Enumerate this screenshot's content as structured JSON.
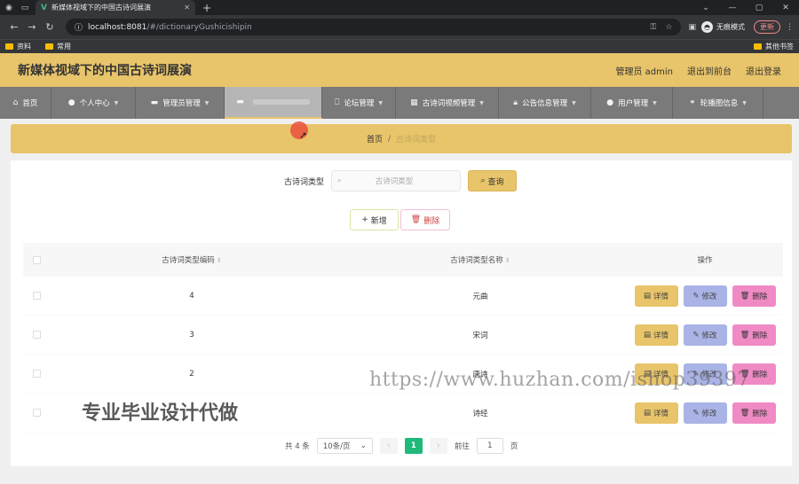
{
  "browser": {
    "tab_title": "新媒体视域下的中国古诗词展演",
    "url_host": "localhost:8081",
    "url_path": "/#/dictionaryGushicishipin",
    "profile_label": "无痕模式",
    "update_label": "更新",
    "bookmarks": [
      "资料",
      "常用"
    ],
    "other_bookmarks": "其他书签"
  },
  "header": {
    "title": "新媒体视域下的中国古诗词展演",
    "user": "管理员 admin",
    "back_front": "退出到前台",
    "logout": "退出登录"
  },
  "menu": [
    {
      "label": "首页",
      "icon": "home-icon"
    },
    {
      "label": "个人中心",
      "icon": "user-icon"
    },
    {
      "label": "管理员管理",
      "icon": "monitor-icon"
    },
    {
      "label": "",
      "icon": "monitor-icon",
      "active": true
    },
    {
      "label": "论坛管理",
      "icon": "forum-icon"
    },
    {
      "label": "古诗词视频管理",
      "icon": "grid-icon"
    },
    {
      "label": "公告信息管理",
      "icon": "lock-icon"
    },
    {
      "label": "用户管理",
      "icon": "user-icon"
    },
    {
      "label": "轮播图信息",
      "icon": "link-icon"
    }
  ],
  "breadcrumb": {
    "home": "首页",
    "sep": "/",
    "current": "古诗词类型"
  },
  "search": {
    "label": "古诗词类型",
    "placeholder": "古诗词类型",
    "query_button": "查询"
  },
  "actions": {
    "add": "新增",
    "delete": "删除"
  },
  "table": {
    "headers": {
      "code": "古诗词类型编码",
      "name": "古诗词类型名称",
      "ops": "操作"
    },
    "rows": [
      {
        "code": "4",
        "name": "元曲"
      },
      {
        "code": "3",
        "name": "宋词"
      },
      {
        "code": "2",
        "name": "唐诗"
      },
      {
        "code": "",
        "name": "诗经"
      }
    ],
    "row_actions": {
      "detail": "详情",
      "edit": "修改",
      "delete": "删除"
    }
  },
  "pagination": {
    "total": "共 4 条",
    "page_size": "10条/页",
    "current_page": "1",
    "goto_label": "前往",
    "goto_value": "1",
    "page_suffix": "页"
  },
  "watermarks": {
    "url": "https://www.huzhan.com/ishop39397",
    "text": "专业毕业设计代做"
  },
  "colors": {
    "accent": "#e8c46a",
    "menu_bg": "#7a7a7a",
    "edit": "#aab3e6",
    "danger": "#f08ac5",
    "page_active": "#1fb97a"
  }
}
